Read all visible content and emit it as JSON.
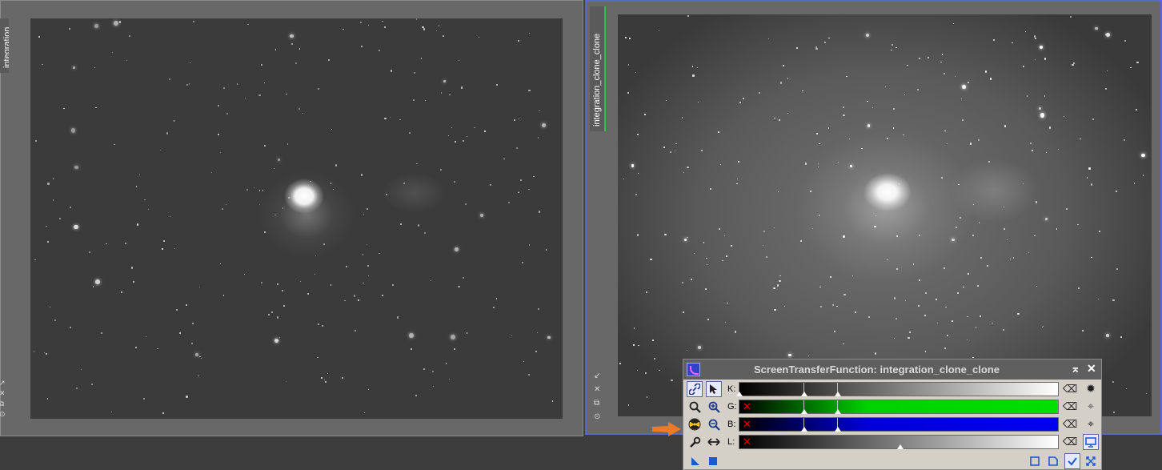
{
  "window1": {
    "tab_label": "integration"
  },
  "window2": {
    "tab_label": "integration_clone_clone"
  },
  "stf": {
    "title": "ScreenTransferFunction: integration_clone_clone",
    "channels": [
      {
        "label": "K:",
        "disabled": false
      },
      {
        "label": "G:",
        "disabled": true
      },
      {
        "label": "B:",
        "disabled": true
      },
      {
        "label": "L:",
        "disabled": true
      }
    ]
  }
}
